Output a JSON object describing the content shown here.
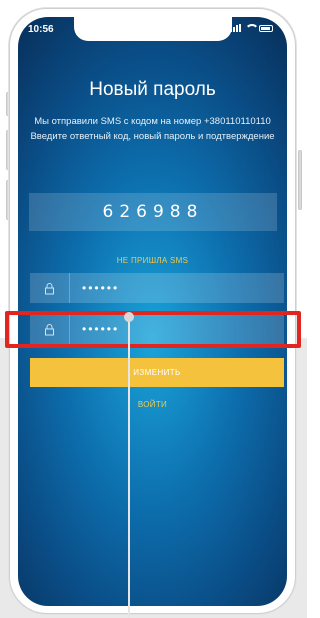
{
  "status_bar": {
    "time": "10:56"
  },
  "header": {
    "title": "Новый пароль",
    "description": "Мы отправили SMS с кодом на номер +380110110110  Введите ответный код, новый пароль и подтверждение"
  },
  "form": {
    "sms_code": "626988",
    "resend_label": "НЕ ПРИШЛА SMS",
    "password_value": "••••••",
    "confirm_value": "••••••",
    "submit_label": "ИЗМЕНИТЬ",
    "login_label": "ВОЙТИ"
  },
  "icons": {
    "field_icon": "lock-icon",
    "signal": "signal-icon",
    "wifi": "wifi-icon",
    "battery": "battery-icon"
  },
  "colors": {
    "accent": "#f5c23d",
    "link": "#f2c94c",
    "highlight": "#e0261f",
    "background_center": "#1aa3d9",
    "background_edge": "#082f5a"
  }
}
